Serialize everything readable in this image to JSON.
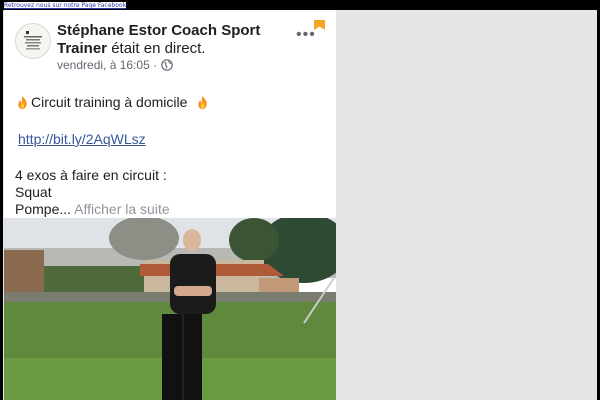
{
  "top_link": "Retrouvez nous sur notre Page Facebook",
  "post": {
    "author_name": "Stéphane Estor Coach Sport Trainer",
    "action": "était en direct.",
    "timestamp": "vendredi, à 16:05 ·",
    "title": "Circuit training à domicile",
    "link": "http://bit.ly/2AqWLsz",
    "line_exos": "4 exos à faire en circuit :",
    "line_squat": "Squat",
    "line_pompe": "Pompe...",
    "see_more": "Afficher la suite"
  },
  "colors": {
    "link": "#365899",
    "bookmark": "#f5a623",
    "meta": "#606770"
  },
  "icons": [
    "fire-icon",
    "globe-icon",
    "more-options-icon",
    "bookmark-icon",
    "avatar"
  ]
}
